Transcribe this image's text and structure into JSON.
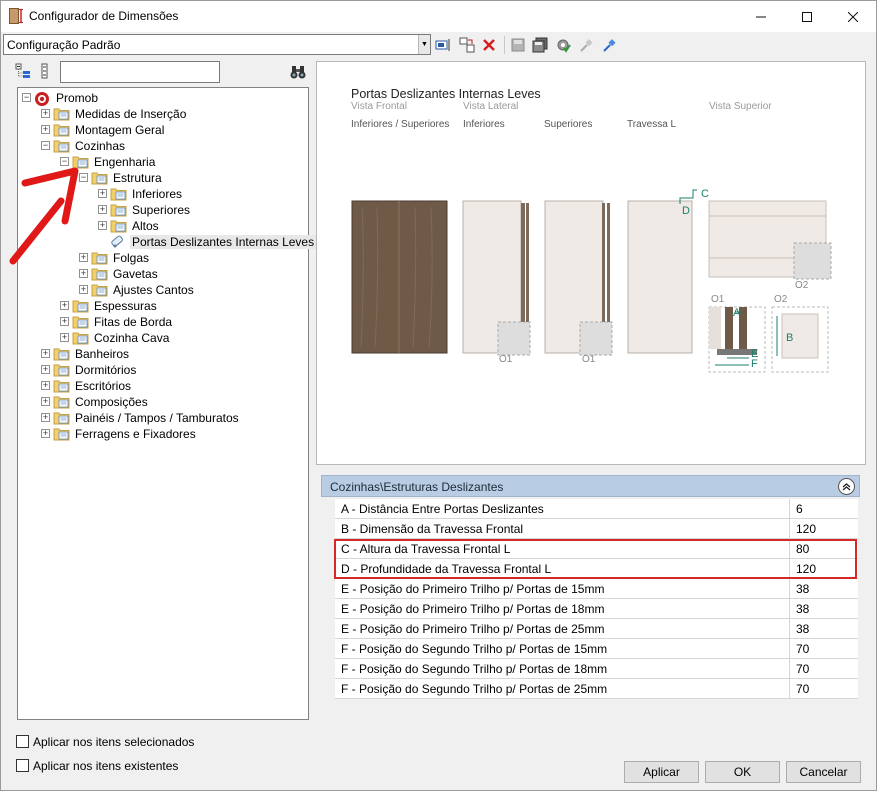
{
  "window": {
    "title": "Configurador de Dimensões"
  },
  "config": {
    "selected": "Configuração Padrão"
  },
  "tree": {
    "root": "Promob",
    "items": [
      "Medidas de Inserção",
      "Montagem Geral",
      "Cozinhas",
      "Engenharia",
      "Estrutura",
      "Inferiores",
      "Superiores",
      "Altos",
      "Portas Deslizantes Internas Leves",
      "Folgas",
      "Gavetas",
      "Ajustes Cantos",
      "Espessuras",
      "Fitas de Borda",
      "Cozinha Cava",
      "Banheiros",
      "Dormitórios",
      "Escritórios",
      "Composições",
      "Painéis / Tampos / Tamburatos",
      "Ferragens e Fixadores"
    ]
  },
  "preview": {
    "title": "Portas Deslizantes Internas Leves",
    "view_frontal": "Vista Frontal",
    "view_lateral": "Vista Lateral",
    "view_superior": "Vista Superior",
    "col_inf_sup": "Inferiores / Superiores",
    "col_inferiores": "Inferiores",
    "col_superiores": "Superiores",
    "col_travessa": "Travessa L",
    "label_o1a": "O1",
    "label_o1b": "O1",
    "label_o2": "O2",
    "label_o1_detail": "O1",
    "label_o2_detail": "O2",
    "dim_c": "C",
    "dim_d": "D",
    "dim_a": "A",
    "dim_b": "B",
    "dim_e": "E",
    "dim_f": "F"
  },
  "props": {
    "header": "Cozinhas\\Estruturas Deslizantes",
    "rows": [
      {
        "name": "A - Distância Entre Portas Deslizantes",
        "value": "6"
      },
      {
        "name": "B - Dimensão da Travessa Frontal",
        "value": "120"
      },
      {
        "name": "C - Altura da Travessa Frontal L",
        "value": "80"
      },
      {
        "name": "D - Profundidade da Travessa Frontal L",
        "value": "120"
      },
      {
        "name": "E - Posição do Primeiro Trilho p/ Portas de 15mm",
        "value": "38"
      },
      {
        "name": "E - Posição do Primeiro Trilho p/ Portas de 18mm",
        "value": "38"
      },
      {
        "name": "E - Posição do Primeiro Trilho p/ Portas de 25mm",
        "value": "38"
      },
      {
        "name": "F - Posição do Segundo Trilho p/ Portas de 15mm",
        "value": "70"
      },
      {
        "name": "F - Posição do Segundo Trilho p/ Portas de 18mm",
        "value": "70"
      },
      {
        "name": "F - Posição do Segundo Trilho p/ Portas de 25mm",
        "value": "70"
      }
    ]
  },
  "options": {
    "apply_selected": "Aplicar nos itens selecionados",
    "apply_existing": "Aplicar nos itens existentes"
  },
  "buttons": {
    "apply": "Aplicar",
    "ok": "OK",
    "cancel": "Cancelar"
  },
  "colors": {
    "highlight": "#d62828",
    "header_bg": "#b8cde3",
    "wood": "#6f5a48",
    "accent_green": "#1a7f6e"
  }
}
